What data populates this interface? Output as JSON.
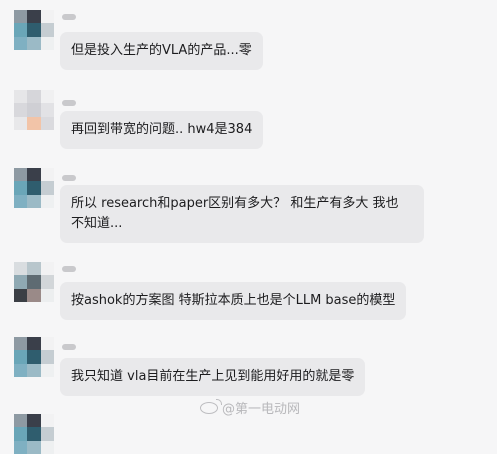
{
  "messages": [
    {
      "text": "但是投入生产的VLA的产品...零"
    },
    {
      "text": "再回到带宽的问题.. hw4是384"
    },
    {
      "text": "所以 research和paper区别有多大？ 和生产有多大 我也\n不知道..."
    },
    {
      "text": "按ashok的方案图 特斯拉本质上也是个LLM base的模型"
    },
    {
      "text": "我只知道 vla目前在生产上见到能用好用的就是零"
    }
  ],
  "watermark": {
    "icon": "weibo-icon",
    "text": "@第一电动网"
  }
}
